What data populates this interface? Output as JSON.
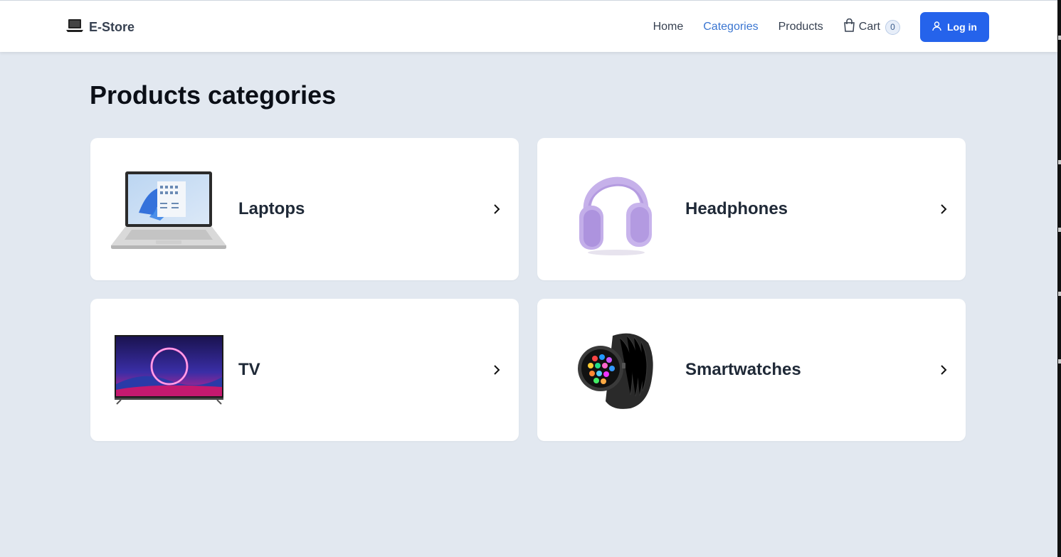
{
  "brand": {
    "name": "E-Store",
    "icon": "laptop-icon"
  },
  "nav": {
    "home": "Home",
    "categories": "Categories",
    "products": "Products",
    "cart_label": "Cart",
    "cart_count": "0",
    "login": "Log in"
  },
  "page": {
    "title": "Products categories"
  },
  "categories": [
    {
      "label": "Laptops",
      "image": "laptop-image"
    },
    {
      "label": "Headphones",
      "image": "headphones-image"
    },
    {
      "label": "TV",
      "image": "tv-image"
    },
    {
      "label": "Smartwatches",
      "image": "smartwatch-image"
    }
  ],
  "colors": {
    "background": "#e2e8f0",
    "accent": "#2563eb",
    "active_link": "#3b76d1"
  }
}
